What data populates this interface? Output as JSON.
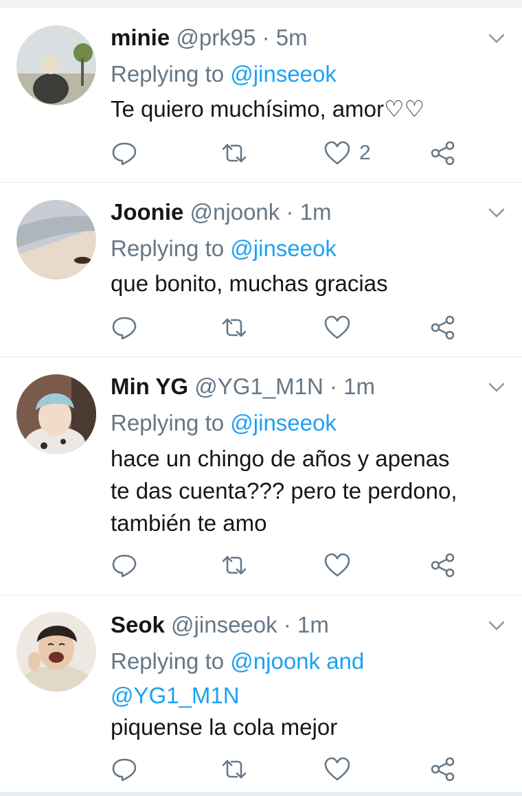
{
  "colors": {
    "accent": "#1da1f2",
    "secondary_text": "#657786",
    "divider": "#e6ecf0"
  },
  "tweets": [
    {
      "name": "minie",
      "handle": "@prk95",
      "separator": "·",
      "time": "5m",
      "reply_prefix": "Replying to",
      "reply_to": "@jinseeok",
      "text": "Te quiero muchísimo, amor♡♡",
      "like_count": "2",
      "icons": [
        "reply-icon",
        "retweet-icon",
        "like-icon",
        "share-icon",
        "caret-down-icon"
      ]
    },
    {
      "name": "Joonie",
      "handle": "@njoonk",
      "separator": "·",
      "time": "1m",
      "reply_prefix": "Replying to",
      "reply_to": "@jinseeok",
      "text": "que bonito, muchas gracias",
      "like_count": ""
    },
    {
      "name": "Min YG",
      "handle": "@YG1_M1N",
      "separator": "·",
      "time": "1m",
      "reply_prefix": "Replying to",
      "reply_to": "@jinseeok",
      "text_lines": [
        "hace un chingo de años y apenas",
        "te das cuenta??? pero te perdono,",
        "también te amo"
      ],
      "like_count": ""
    },
    {
      "name": "Seok",
      "handle": "@jinseeok",
      "separator": "·",
      "time": "1m",
      "reply_prefix": "Replying to",
      "reply_to": "@njoonk and",
      "reply_to_line2": "@YG1_M1N",
      "text": "piquense la cola mejor",
      "like_count": ""
    }
  ]
}
